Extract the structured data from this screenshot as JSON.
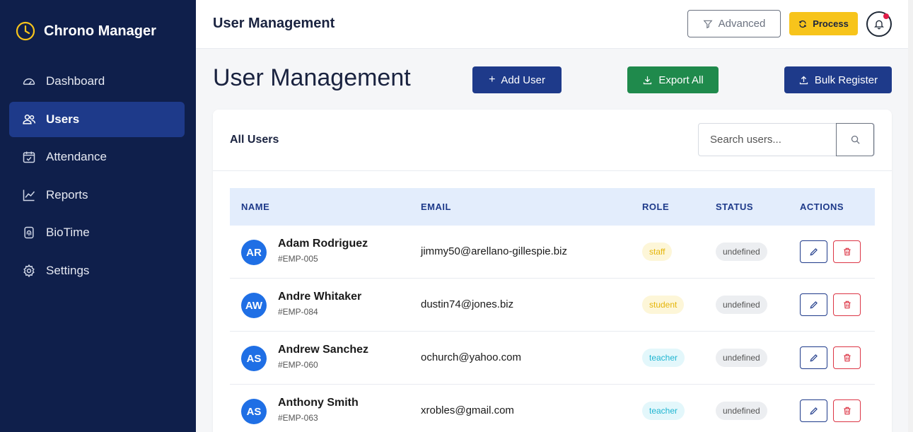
{
  "sidebar": {
    "brand": "Chrono Manager",
    "items": [
      {
        "label": "Dashboard",
        "icon": "gauge-icon"
      },
      {
        "label": "Users",
        "icon": "users-icon",
        "active": true
      },
      {
        "label": "Attendance",
        "icon": "calendar-check-icon"
      },
      {
        "label": "Reports",
        "icon": "line-chart-icon"
      },
      {
        "label": "BioTime",
        "icon": "fingerprint-icon"
      },
      {
        "label": "Settings",
        "icon": "gear-icon"
      }
    ]
  },
  "topbar": {
    "title": "User Management",
    "advanced_label": "Advanced",
    "process_label": "Process"
  },
  "main": {
    "title": "User Management",
    "add_user_label": "Add User",
    "export_label": "Export All",
    "bulk_label": "Bulk Register"
  },
  "users_card": {
    "title": "All Users",
    "search_placeholder": "Search users...",
    "columns": [
      "NAME",
      "EMAIL",
      "ROLE",
      "STATUS",
      "ACTIONS"
    ],
    "rows": [
      {
        "initials": "AR",
        "name": "Adam Rodriguez",
        "id": "#EMP-005",
        "email": "jimmy50@arellano-gillespie.biz",
        "role": "staff",
        "status": "undefined"
      },
      {
        "initials": "AW",
        "name": "Andre Whitaker",
        "id": "#EMP-084",
        "email": "dustin74@jones.biz",
        "role": "student",
        "status": "undefined"
      },
      {
        "initials": "AS",
        "name": "Andrew Sanchez",
        "id": "#EMP-060",
        "email": "ochurch@yahoo.com",
        "role": "teacher",
        "status": "undefined"
      },
      {
        "initials": "AS",
        "name": "Anthony Smith",
        "id": "#EMP-063",
        "email": "xrobles@gmail.com",
        "role": "teacher",
        "status": "undefined"
      }
    ]
  },
  "colors": {
    "sidebar_bg": "#0f1f4b",
    "primary": "#1e3a8a",
    "success": "#1f8a4c",
    "warning": "#f7c41b",
    "danger": "#dc3545",
    "avatar": "#1f6fe5"
  }
}
